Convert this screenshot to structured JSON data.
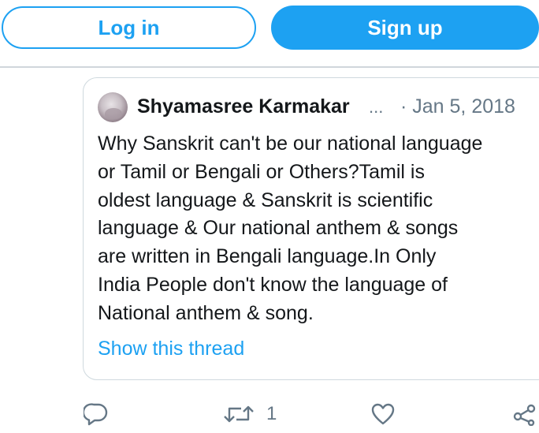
{
  "header": {
    "login_label": "Log in",
    "signup_label": "Sign up"
  },
  "tweet": {
    "author": "Shyamasree Karmakar",
    "ellipsis": "...",
    "date": "· Jan 5, 2018",
    "text": "Why Sanskrit can't be our national language\nor Tamil or Bengali or Others?Tamil is\noldest language & Sanskrit is scientific\nlanguage & Our  national anthem & songs\nare written in Bengali language.In Only\nIndia People don't know the language of\nNational anthem & song.",
    "show_thread": "Show this thread",
    "actions": {
      "reply_icon": "reply-icon",
      "retweet_icon": "retweet-icon",
      "retweet_count": "1",
      "like_icon": "heart-icon",
      "share_icon": "share-icon"
    }
  },
  "colors": {
    "accent": "#1da1f2",
    "secondary_text": "#657786",
    "border": "#cfd9de"
  }
}
